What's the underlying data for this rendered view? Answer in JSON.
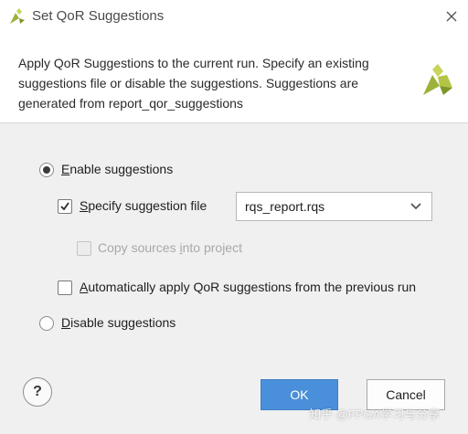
{
  "window": {
    "title": "Set QoR Suggestions",
    "logo_icon": "vivado-logo-icon",
    "close_icon": "close-icon"
  },
  "header": {
    "description": "Apply QoR Suggestions to the current run. Specify an existing suggestions file or disable the suggestions. Suggestions are generated from report_qor_suggestions",
    "logo_icon": "vivado-logo-icon"
  },
  "options": {
    "enable_suggestions": {
      "label_first": "E",
      "label_rest": "nable suggestions",
      "selected": true
    },
    "specify_file": {
      "label_first": "S",
      "label_rest": "pecify suggestion file",
      "checked": true
    },
    "file_combo": {
      "value": "rqs_report.rqs"
    },
    "copy_sources": {
      "label_pre": "Copy sources ",
      "label_u": "i",
      "label_post": "nto project",
      "checked": false,
      "enabled": false
    },
    "auto_apply": {
      "label_first": "A",
      "label_rest": "utomatically apply QoR suggestions from the previous run",
      "checked": false
    },
    "disable_suggestions": {
      "label_first": "D",
      "label_rest": "isable suggestions",
      "selected": false
    }
  },
  "footer": {
    "help_label": "?",
    "ok_label": "OK",
    "cancel_label": "Cancel"
  },
  "watermark": "知乎 @FPGA学习与分享",
  "colors": {
    "accent": "#4a8fd9",
    "logo_green": "#9bb23a"
  }
}
